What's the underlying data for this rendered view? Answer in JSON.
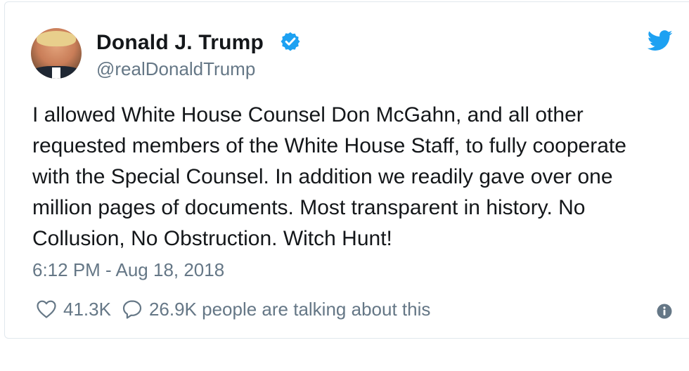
{
  "tweet": {
    "display_name": "Donald J. Trump",
    "handle": "@realDonaldTrump",
    "verified": true,
    "text_lines": [
      "I allowed White House Counsel Don McGahn, and all other",
      "requested members of the White House Staff, to fully cooperate",
      "with the Special Counsel. In addition we readily gave over one",
      "million pages of documents. Most transparent in history. No",
      "Collusion, No Obstruction. Witch Hunt!"
    ],
    "timestamp": "6:12 PM - Aug 18, 2018",
    "likes": "41.3K",
    "talking": "26.9K people are talking about this"
  },
  "icons": {
    "avatar": "avatar",
    "verified": "verified-badge-icon",
    "brand": "twitter-bird-icon",
    "like": "heart-icon",
    "reply": "speech-bubble-icon",
    "info": "info-icon"
  },
  "colors": {
    "brand": "#1da1f2",
    "text": "#14171a",
    "muted": "#657786",
    "border": "#e1e8ed"
  }
}
